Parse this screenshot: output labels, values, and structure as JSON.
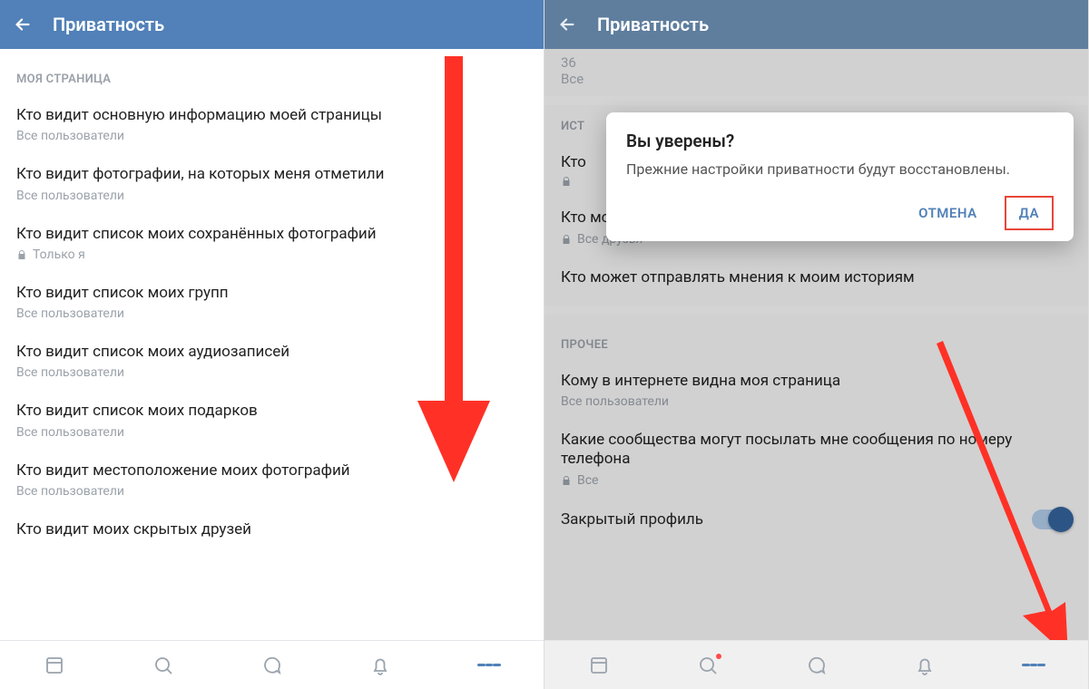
{
  "colors": {
    "brand": "#5181B8",
    "arrow": "#ff3126",
    "muted": "#99a0a8"
  },
  "left": {
    "title": "Приватность",
    "section1": "МОЯ СТРАНИЦА",
    "items": [
      {
        "label": "Кто видит основную информацию моей страницы",
        "sub": "Все пользователи",
        "locked": false
      },
      {
        "label": "Кто видит фотографии, на которых меня отметили",
        "sub": "Все пользователи",
        "locked": false
      },
      {
        "label": "Кто видит список моих сохранённых фотографий",
        "sub": "Только я",
        "locked": true
      },
      {
        "label": "Кто видит список моих групп",
        "sub": "Все пользователи",
        "locked": false
      },
      {
        "label": "Кто видит список моих аудиозаписей",
        "sub": "Все пользователи",
        "locked": false
      },
      {
        "label": "Кто видит список моих подарков",
        "sub": "Все пользователи",
        "locked": false
      },
      {
        "label": "Кто видит местоположение моих фотографий",
        "sub": "Все пользователи",
        "locked": false
      },
      {
        "label": "Кто видит моих скрытых друзей",
        "sub": "",
        "locked": false
      }
    ]
  },
  "right": {
    "title": "Приватность",
    "partial": {
      "value": "36",
      "sub": "Все"
    },
    "sec_hist": "ИСТ",
    "items_top": [
      {
        "label_prefix": "Кто",
        "sub": "",
        "locked": true
      },
      {
        "label": "Кто может отвечать на мои истории",
        "sub": "Все друзья",
        "locked": true
      },
      {
        "label": "Кто может отправлять мнения к моим историям",
        "sub": "",
        "locked": false
      }
    ],
    "sec_other": "ПРОЧЕЕ",
    "items_other": [
      {
        "label": "Кому в интернете видна моя страница",
        "sub": "Все пользователи",
        "locked": false
      },
      {
        "label": "Какие сообщества могут посылать мне сообщения по номеру телефона",
        "sub": "Все",
        "locked": true
      }
    ],
    "toggle": {
      "label": "Закрытый профиль",
      "on": true
    },
    "dialog": {
      "title": "Вы уверены?",
      "message": "Прежние настройки приватности будут восстановлены.",
      "cancel": "ОТМЕНА",
      "ok": "ДА"
    }
  }
}
